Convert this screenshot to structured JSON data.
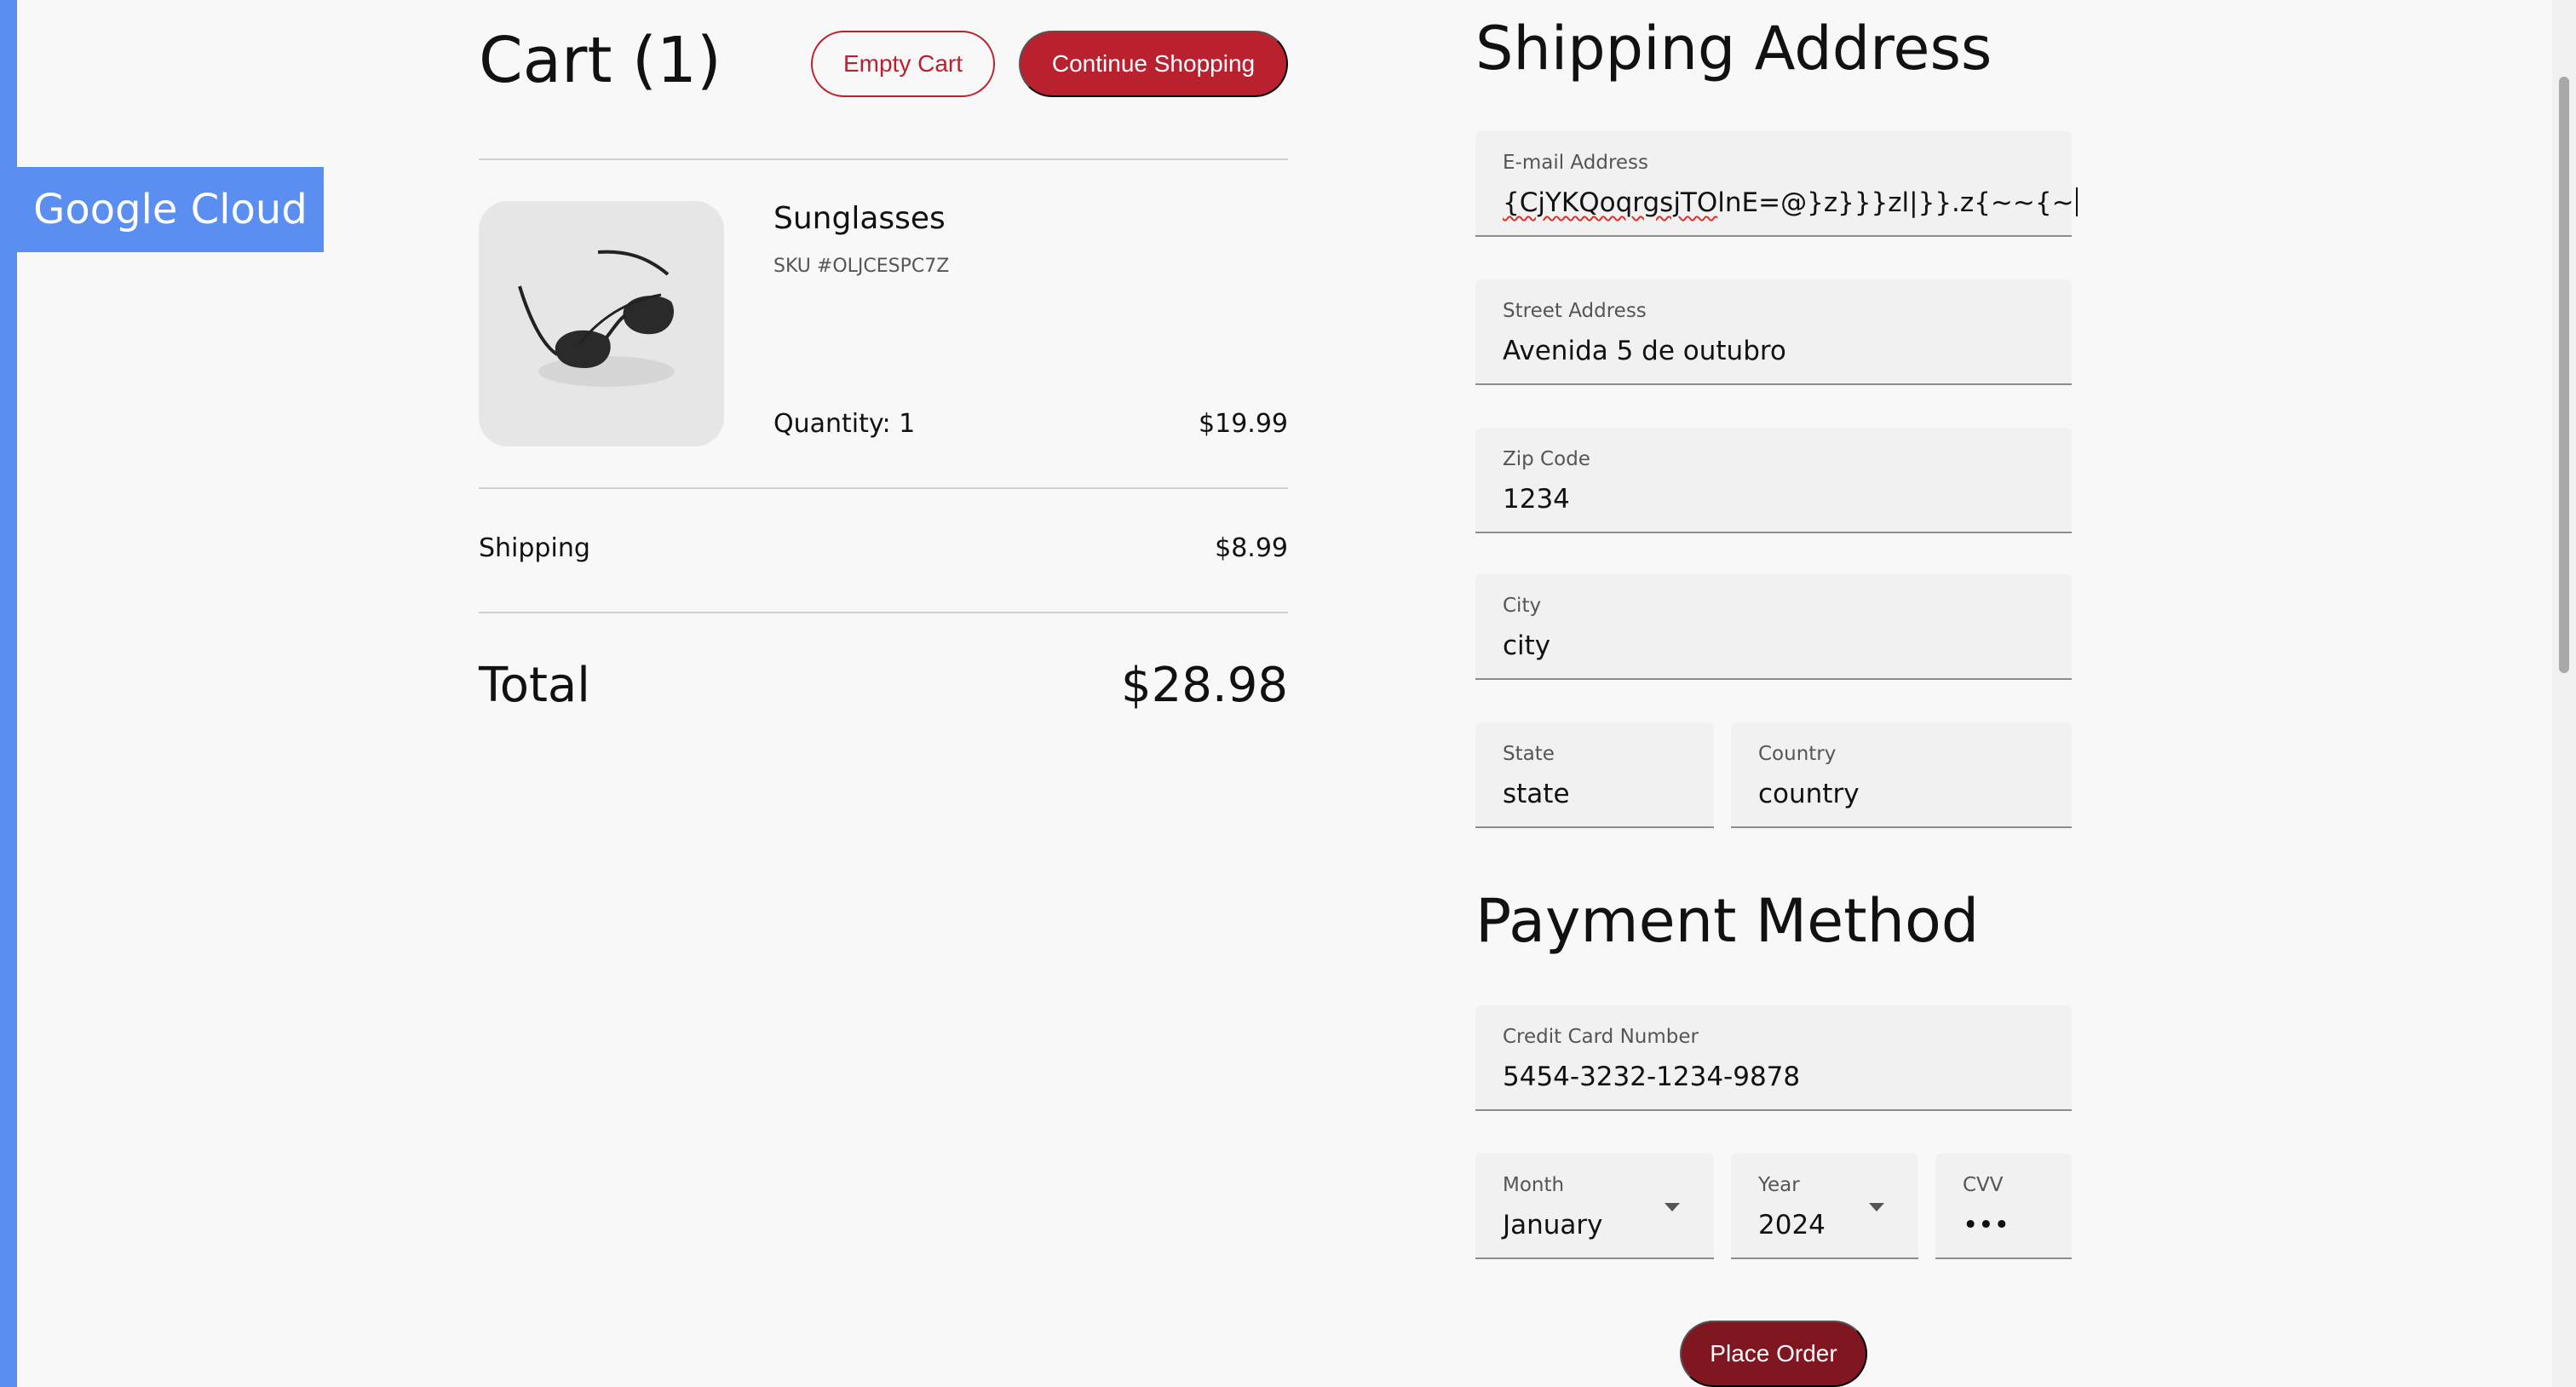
{
  "brand": {
    "name": "Google Cloud"
  },
  "cart": {
    "title": "Cart (1)",
    "empty_label": "Empty Cart",
    "continue_label": "Continue Shopping",
    "item": {
      "name": "Sunglasses",
      "sku": "SKU #OLJCESPC7Z",
      "quantity": "Quantity: 1",
      "price": "$19.99",
      "image_icon": "sunglasses-image"
    },
    "shipping_label": "Shipping",
    "shipping_value": "$8.99",
    "total_label": "Total",
    "total_value": "$28.98"
  },
  "shipping": {
    "title": "Shipping Address",
    "email": {
      "label": "E-mail Address",
      "value_underlined": "{CjYKQoqrgsjTO",
      "value_rest": "lnE=@}z}}}zl|}}.z{~~{~"
    },
    "street": {
      "label": "Street Address",
      "value": "Avenida 5 de outubro"
    },
    "zip": {
      "label": "Zip Code",
      "value": "1234"
    },
    "city": {
      "label": "City",
      "value": "city"
    },
    "state": {
      "label": "State",
      "value": "state"
    },
    "country": {
      "label": "Country",
      "value": "country"
    }
  },
  "payment": {
    "title": "Payment Method",
    "card": {
      "label": "Credit Card Number",
      "value": "5454-3232-1234-9878"
    },
    "month": {
      "label": "Month",
      "value": "January"
    },
    "year": {
      "label": "Year",
      "value": "2024"
    },
    "cvv": {
      "label": "CVV",
      "value": "•••"
    },
    "submit_label": "Place Order"
  },
  "colors": {
    "accent": "#b9212f",
    "place_order": "#7f1620",
    "brand": "#5a8ef0"
  }
}
